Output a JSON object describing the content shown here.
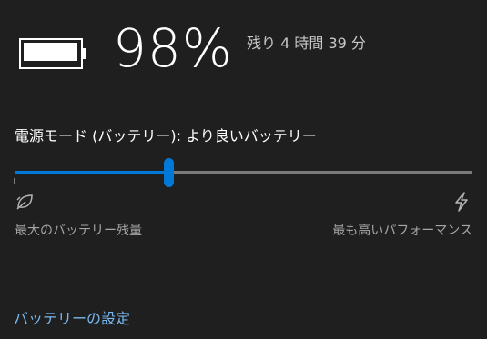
{
  "battery": {
    "percent_text": "98%",
    "level_fraction": 0.98,
    "remaining_text": "残り 4 時間 39 分",
    "icon": "battery-icon"
  },
  "power_mode": {
    "label": "電源モード (バッテリー): より良いバッテリー",
    "slider_value_fraction": 0.335,
    "tick_fractions": [
      0.0,
      0.333,
      0.667,
      1.0
    ],
    "left_icon": "leaf-icon",
    "right_icon": "bolt-icon",
    "left_label": "最大のバッテリー残量",
    "right_label": "最も高いパフォーマンス"
  },
  "link": {
    "battery_settings": "バッテリーの設定"
  },
  "colors": {
    "background": "#1f1f1f",
    "accent": "#0078d7",
    "link": "#78b7ef",
    "secondary_text": "#a6a6a6"
  }
}
